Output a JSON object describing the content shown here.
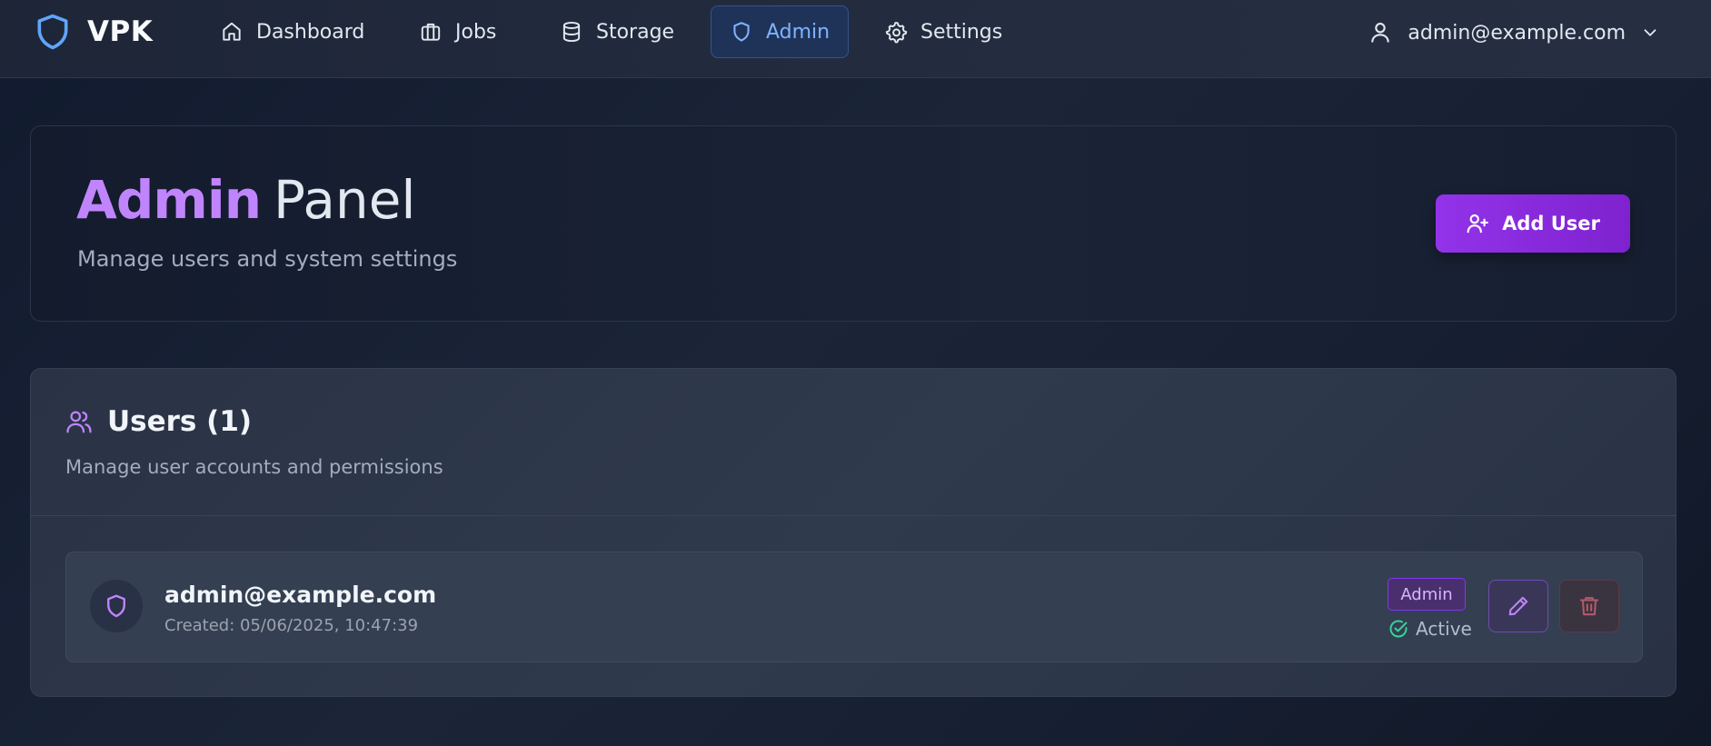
{
  "app": {
    "brand": "VPK"
  },
  "nav": {
    "items": [
      {
        "label": "Dashboard",
        "icon": "home-icon"
      },
      {
        "label": "Jobs",
        "icon": "briefcase-icon"
      },
      {
        "label": "Storage",
        "icon": "database-icon"
      },
      {
        "label": "Admin",
        "icon": "shield-icon",
        "active": true
      },
      {
        "label": "Settings",
        "icon": "gear-icon"
      }
    ],
    "user_email": "admin@example.com"
  },
  "header": {
    "title_bold": "Admin",
    "title_rest": "Panel",
    "subtitle": "Manage users and system settings",
    "add_user_label": "Add User"
  },
  "users": {
    "title": "Users (1)",
    "subtitle": "Manage user accounts and permissions",
    "rows": [
      {
        "email": "admin@example.com",
        "created": "Created: 05/06/2025, 10:47:39",
        "role": "Admin",
        "status": "Active"
      }
    ]
  },
  "colors": {
    "accent_purple": "#9333ea",
    "active_nav_blue": "#7fb3ff",
    "status_green": "#34d399",
    "delete_red": "#b45a68"
  }
}
